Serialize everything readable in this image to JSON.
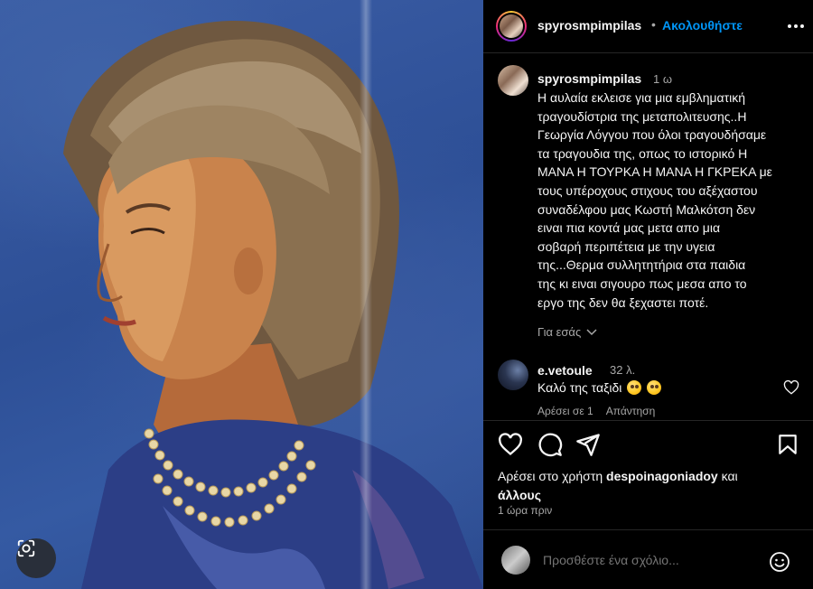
{
  "header": {
    "username": "spyrosmpimpilas",
    "separator": "•",
    "follow_label": "Ακολουθήστε"
  },
  "caption": {
    "username": "spyrosmpimpilas",
    "time": "1 ω",
    "text": "Η αυλαία εκλεισε για μια εμβληματική\nτραγουδίστρια της μεταπολιτευσης..Η\nΓεωργία Λόγγου που όλοι τραγουδήσαμε\nτα τραγουδια της, οπως το ιστορικό Η\nΜΑΝΑ Η ΤΟΥΡΚΑ Η ΜΑΝΑ Η ΓΚΡΕΚΑ με\nτους υπέροχους στιχους του αξέχαστου\nσυναδέλφου μας Κωστή Μαλκότση δεν\nειναι πια κοντά μας μετα απο μια\nσοβαρή περιπέτεια με την υγεια\nτης...Θερμα συλλητητήρια στα παιδια\nτης κι ειναι σιγουρο πως μεσα απο το\nεργο της δεν θα ξεχαστει ποτέ.",
    "translate_label": "Για εσάς"
  },
  "comment": {
    "username": "e.vetoule",
    "time": "32 λ.",
    "text": "Καλό της ταξιδι",
    "likes_label": "Αρέσει σε 1",
    "reply_label": "Απάντηση"
  },
  "likes": {
    "prefix": "Αρέσει στο χρήστη ",
    "user": "despoinagoniadoy",
    "middle": " και",
    "others": "άλλους"
  },
  "posted_time": "1 ώρα πριν",
  "add_comment": {
    "placeholder": "Προσθέστε ένα σχόλιο..."
  },
  "icons": {
    "more": "more-horizontal-icon",
    "heart": "heart-icon",
    "comment": "comment-icon",
    "share": "share-icon",
    "save": "bookmark-icon",
    "lens": "visual-search-icon",
    "emoji": "emoji-icon"
  },
  "colors": {
    "accent": "#0095f6",
    "muted": "#a8a8a8",
    "background": "#000000"
  }
}
